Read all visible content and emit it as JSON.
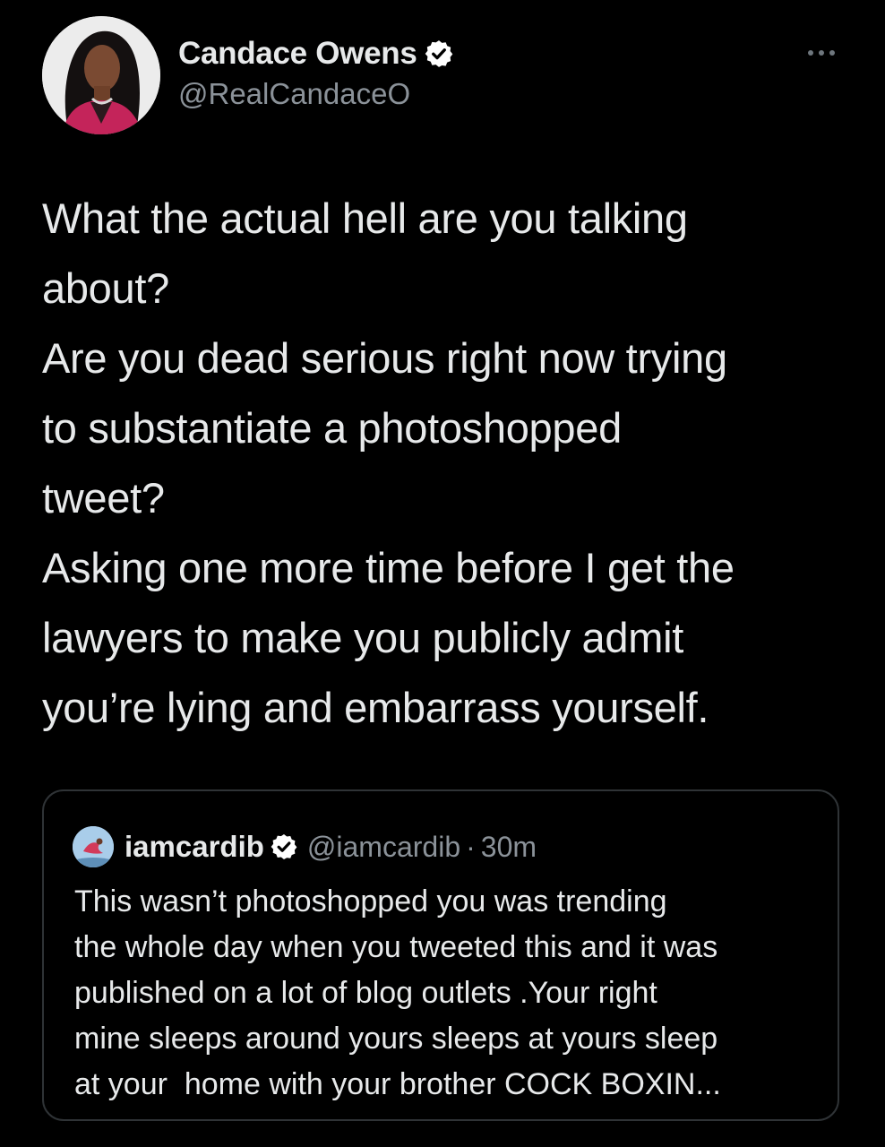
{
  "tweet": {
    "author": {
      "display_name": "Candace Owens",
      "handle": "@RealCandaceO",
      "verified": true
    },
    "more_icon": "more-horizontal-icon",
    "body_lines": [
      "What the actual hell are you talking",
      "about?",
      "Are you dead serious right now trying",
      "to substantiate a photoshopped",
      "tweet?",
      "Asking one more time before I get the",
      "lawyers to make you publicly admit",
      "you’re lying and embarrass yourself."
    ],
    "quoted_tweet": {
      "display_name": "iamcardib",
      "verified": true,
      "handle": "@iamcardib",
      "separator": "·",
      "time": "30m",
      "body_lines": [
        "This wasn’t photoshopped you was trending",
        "the whole day when you tweeted this and it was",
        "published on a lot of blog outlets .Your right",
        "mine sleeps around yours sleeps at yours sleep",
        "at your  home with your brother COCK BOXIN..."
      ]
    }
  },
  "colors": {
    "background": "#000000",
    "text_primary": "#e7e9ea",
    "text_secondary": "#8b9299",
    "verified_badge": "#ffffff",
    "border": "#2f3336"
  }
}
